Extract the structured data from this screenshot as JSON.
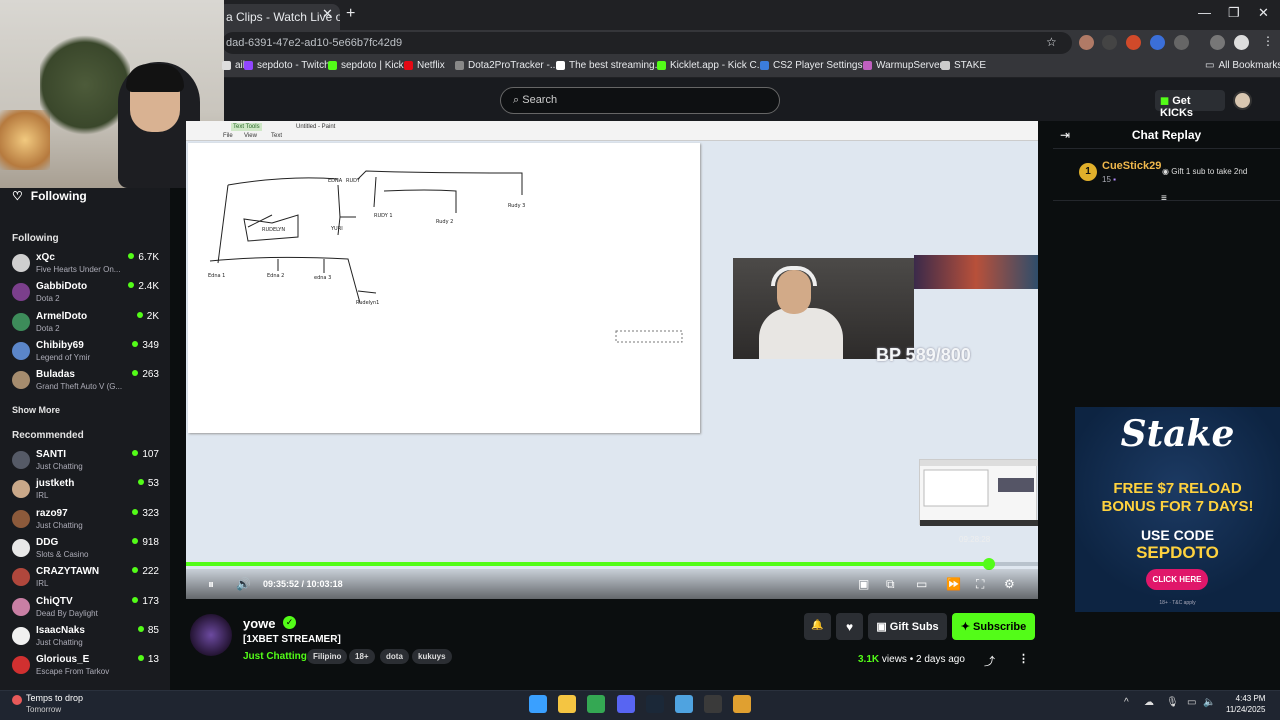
{
  "browser": {
    "tab_title": "a Clips - Watch Live on Kic",
    "tab_close": "✕",
    "new_tab": "+",
    "address": "dad-6391-47e2-ad10-5e66b7fc42d9",
    "window_controls": [
      "—",
      "❐",
      "✕"
    ],
    "bookmarks": [
      {
        "label": "ail",
        "color": "#dddddd"
      },
      {
        "label": "sepdoto - Twitch",
        "color": "#9146ff"
      },
      {
        "label": "sepdoto | Kick",
        "color": "#53fc18"
      },
      {
        "label": "Netflix",
        "color": "#e50914"
      },
      {
        "label": "Dota2ProTracker -...",
        "color": "#888888"
      },
      {
        "label": "The best streaming...",
        "color": "#ffffff"
      },
      {
        "label": "Kicklet.app - Kick C...",
        "color": "#53fc18"
      },
      {
        "label": "CS2 Player Settings...",
        "color": "#3b7ddd"
      },
      {
        "label": "WarmupServer",
        "color": "#c060c0"
      },
      {
        "label": "STAKE",
        "color": "#cccccc"
      }
    ],
    "all_bookmarks": "All Bookmarks"
  },
  "header": {
    "search_placeholder": "Search",
    "search_icon": "⌕",
    "get_kicks": "Get KICKs"
  },
  "sidebar": {
    "following_link": "Following",
    "following_title": "Following",
    "following": [
      {
        "name": "xQc",
        "game": "Five Hearts Under On...",
        "viewers": "6.7K",
        "color": "#cfcfcf"
      },
      {
        "name": "GabbiDoto",
        "game": "Dota 2",
        "viewers": "2.4K",
        "color": "#7b3f8c"
      },
      {
        "name": "ArmelDoto",
        "game": "Dota 2",
        "viewers": "2K",
        "color": "#3d8c5a"
      },
      {
        "name": "Chibiby69",
        "game": "Legend of Ymir",
        "viewers": "349",
        "color": "#5b86c9"
      },
      {
        "name": "Buladas",
        "game": "Grand Theft Auto V (G...",
        "viewers": "263",
        "color": "#a58c6e"
      }
    ],
    "show_more": "Show More",
    "recommended_title": "Recommended",
    "recommended": [
      {
        "name": "SANTI",
        "game": "Just Chatting",
        "viewers": "107",
        "color": "#555a66"
      },
      {
        "name": "justketh",
        "game": "IRL",
        "viewers": "53",
        "color": "#c9a889"
      },
      {
        "name": "razo97",
        "game": "Just Chatting",
        "viewers": "323",
        "color": "#8c5a3b"
      },
      {
        "name": "DDG",
        "game": "Slots & Casino",
        "viewers": "918",
        "color": "#e8e8e8"
      },
      {
        "name": "CRAZYTAWN",
        "game": "IRL",
        "viewers": "222",
        "color": "#b0473c"
      },
      {
        "name": "ChiQTV",
        "game": "Dead By Daylight",
        "viewers": "173",
        "color": "#c97fa4"
      },
      {
        "name": "IsaacNaks",
        "game": "Just Chatting",
        "viewers": "85",
        "color": "#f0f0f0"
      },
      {
        "name": "Glorious_E",
        "game": "Escape From Tarkov",
        "viewers": "13",
        "color": "#d03030"
      }
    ]
  },
  "video": {
    "paint_title": "Untitled - Paint",
    "paint_menu": [
      "File",
      "View",
      "Text"
    ],
    "paint_tab": "Text Tools",
    "tree_labels": [
      "EDNA",
      "RUDY",
      "Rudy 3",
      "RUDY 1",
      "Rudy 2",
      "RUDELYN",
      "YURI",
      "Edna 1",
      "Edna 2",
      "edna 3",
      "Rudelyn1"
    ],
    "overlay_text": "BP 589/800",
    "hover_time": "09:28:28",
    "time_current": "09:35:52",
    "time_total": "10:03:18",
    "progress_fraction": 0.943,
    "play_state": "pause",
    "controls": [
      "⏸",
      "🔊"
    ],
    "right_controls": [
      "▣",
      "⧉",
      "▭",
      "⏩",
      "⛶",
      "⚙"
    ]
  },
  "chat": {
    "title": "Chat Replay",
    "collapse_icon": "⇥",
    "pinned_rank": "1",
    "pinned_user": "CueStick29",
    "pinned_count": "15",
    "pinned_gift": "Gift 1 sub to take 2nd",
    "menu_icon": "≡"
  },
  "ad": {
    "logo": "Stake",
    "promo_line1": "FREE $7 RELOAD",
    "promo_line2": "BONUS FOR 7 DAYS!",
    "use_code": "USE CODE",
    "code": "SEPDOTO",
    "button": "CLICK HERE",
    "fine_print": "18+ · T&C apply"
  },
  "channel": {
    "name": "yowe",
    "verified_icon": "✓",
    "title": "[1XBET STREAMER]",
    "category": "Just Chatting",
    "tags": [
      "Filipino",
      "18+",
      "dota",
      "kukuys"
    ],
    "bell_icon": "🔔",
    "heart_icon": "♥",
    "gift_subs": "Gift Subs",
    "subscribe": "Subscribe",
    "views": "3.1K",
    "views_suffix": "views",
    "age": "2 days ago",
    "share_icon": "⤴",
    "more_icon": "⋮"
  },
  "taskbar": {
    "weather_line1": "Temps to drop",
    "weather_line2": "Tomorrow",
    "time": "4:43 PM",
    "date": "11/24/2025",
    "tray_icons": [
      "^",
      "☁",
      "🎙",
      "▭",
      "🔈"
    ],
    "apps": [
      {
        "name": "windows-start",
        "color": "#3aa0ff"
      },
      {
        "name": "file-explorer",
        "color": "#f4c542"
      },
      {
        "name": "chrome",
        "color": "#34a853"
      },
      {
        "name": "discord",
        "color": "#5865f2"
      },
      {
        "name": "steam",
        "color": "#1b2838"
      },
      {
        "name": "notepad",
        "color": "#4fa3e0"
      },
      {
        "name": "obs",
        "color": "#3a3a3a"
      },
      {
        "name": "editor",
        "color": "#e0a030"
      }
    ]
  }
}
